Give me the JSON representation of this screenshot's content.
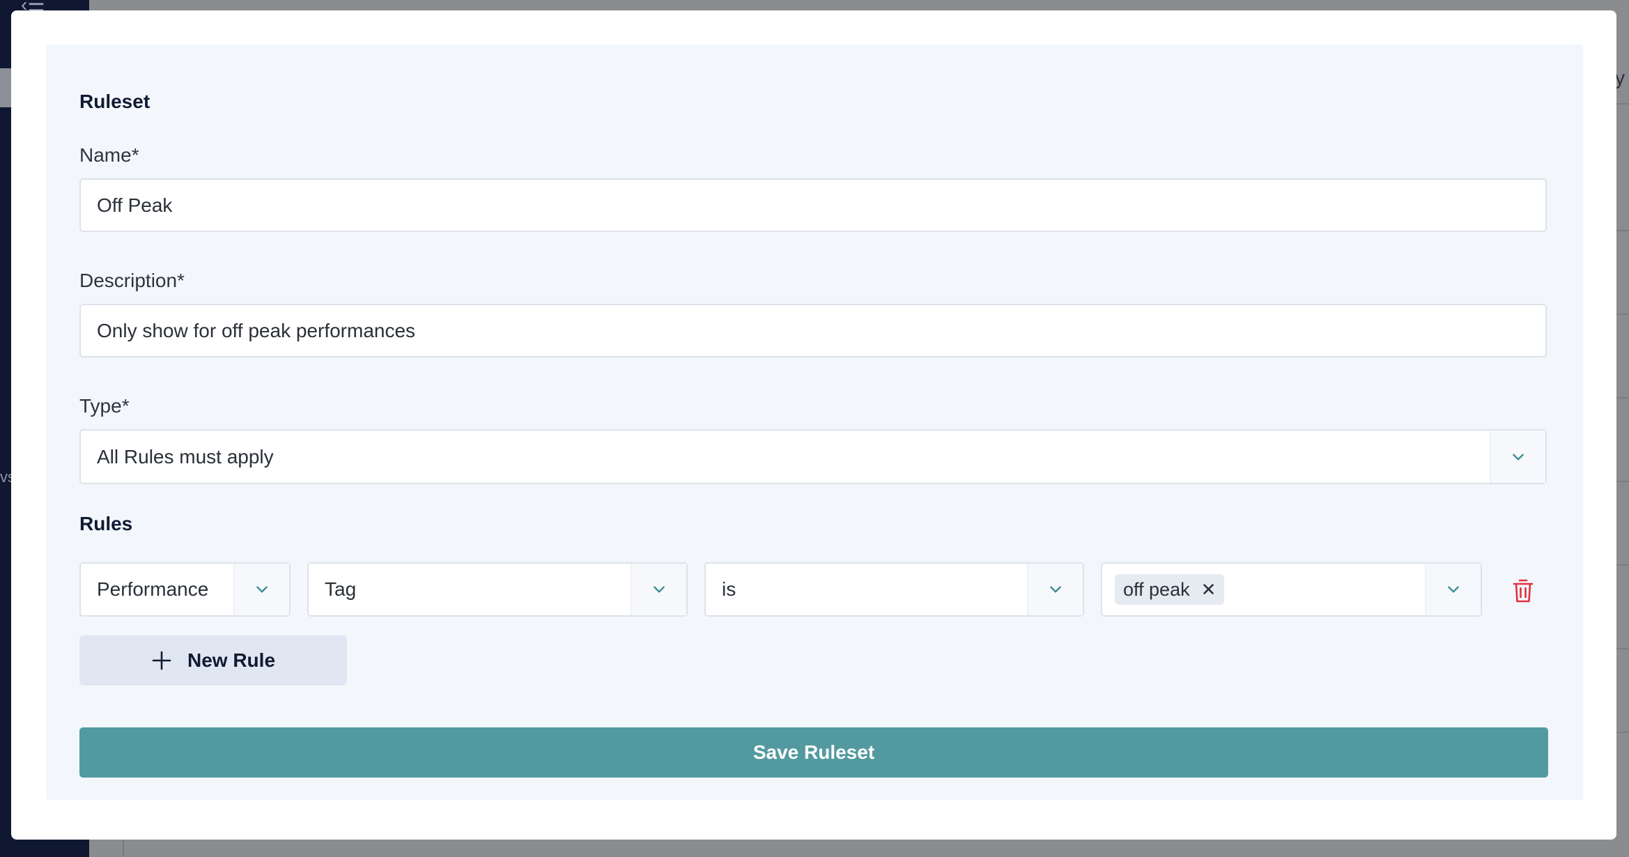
{
  "background": {
    "partial_text_left": "vs",
    "partial_text_right": "y"
  },
  "ruleset": {
    "section_title": "Ruleset",
    "name": {
      "label": "Name*",
      "value": "Off Peak"
    },
    "description": {
      "label": "Description*",
      "value": "Only show for off peak performances"
    },
    "type": {
      "label": "Type*",
      "value": "All Rules must apply"
    }
  },
  "rules": {
    "section_title": "Rules",
    "items": [
      {
        "entity": "Performance",
        "field": "Tag",
        "operator": "is",
        "values": [
          "off peak"
        ]
      }
    ],
    "new_rule_label": "New Rule"
  },
  "save_label": "Save Ruleset",
  "colors": {
    "accent": "#539aa0",
    "danger": "#e0313d",
    "chevron": "#3a8a93"
  }
}
